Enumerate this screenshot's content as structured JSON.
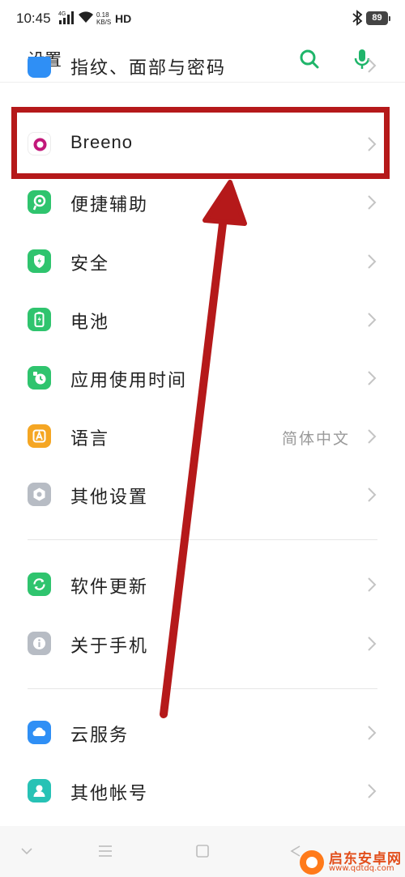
{
  "status_bar": {
    "time": "10:45",
    "network": "4G",
    "speed_value": "0.18",
    "speed_unit": "KB/S",
    "hd": "HD",
    "battery": "89"
  },
  "header": {
    "title": "设置",
    "search_icon": "search-icon",
    "voice_icon": "microphone-icon",
    "accent_color": "#1fb56a"
  },
  "settings": {
    "partial_top": {
      "label": "指纹、面部与密码",
      "icon": "fingerprint-icon",
      "icon_color": "#2f8ff5"
    },
    "items": [
      {
        "label": "Breeno",
        "icon": "breeno-icon",
        "icon_color": "#c2187a"
      },
      {
        "label": "便捷辅助",
        "icon": "assist-icon",
        "icon_color": "#2fc46e"
      },
      {
        "label": "安全",
        "icon": "shield-icon",
        "icon_color": "#2fc46e"
      },
      {
        "label": "电池",
        "icon": "battery-icon",
        "icon_color": "#2fc46e"
      },
      {
        "label": "应用使用时间",
        "icon": "app-usage-icon",
        "icon_color": "#2fc46e"
      },
      {
        "label": "语言",
        "value": "简体中文",
        "icon": "language-icon",
        "icon_color": "#f5a623"
      },
      {
        "label": "其他设置",
        "icon": "more-settings-icon",
        "icon_color": "#b7bcc4"
      },
      {
        "label": "软件更新",
        "icon": "software-update-icon",
        "icon_color": "#2fc46e"
      },
      {
        "label": "关于手机",
        "icon": "about-phone-icon",
        "icon_color": "#b7bcc4"
      },
      {
        "label": "云服务",
        "icon": "cloud-icon",
        "icon_color": "#2f8ff5"
      },
      {
        "label": "其他帐号",
        "icon": "account-icon",
        "icon_color": "#27c2b5"
      }
    ]
  },
  "annotation": {
    "color": "#b5191a"
  },
  "watermark": {
    "name": "启东安卓网",
    "url": "www.qdtdq.com"
  }
}
